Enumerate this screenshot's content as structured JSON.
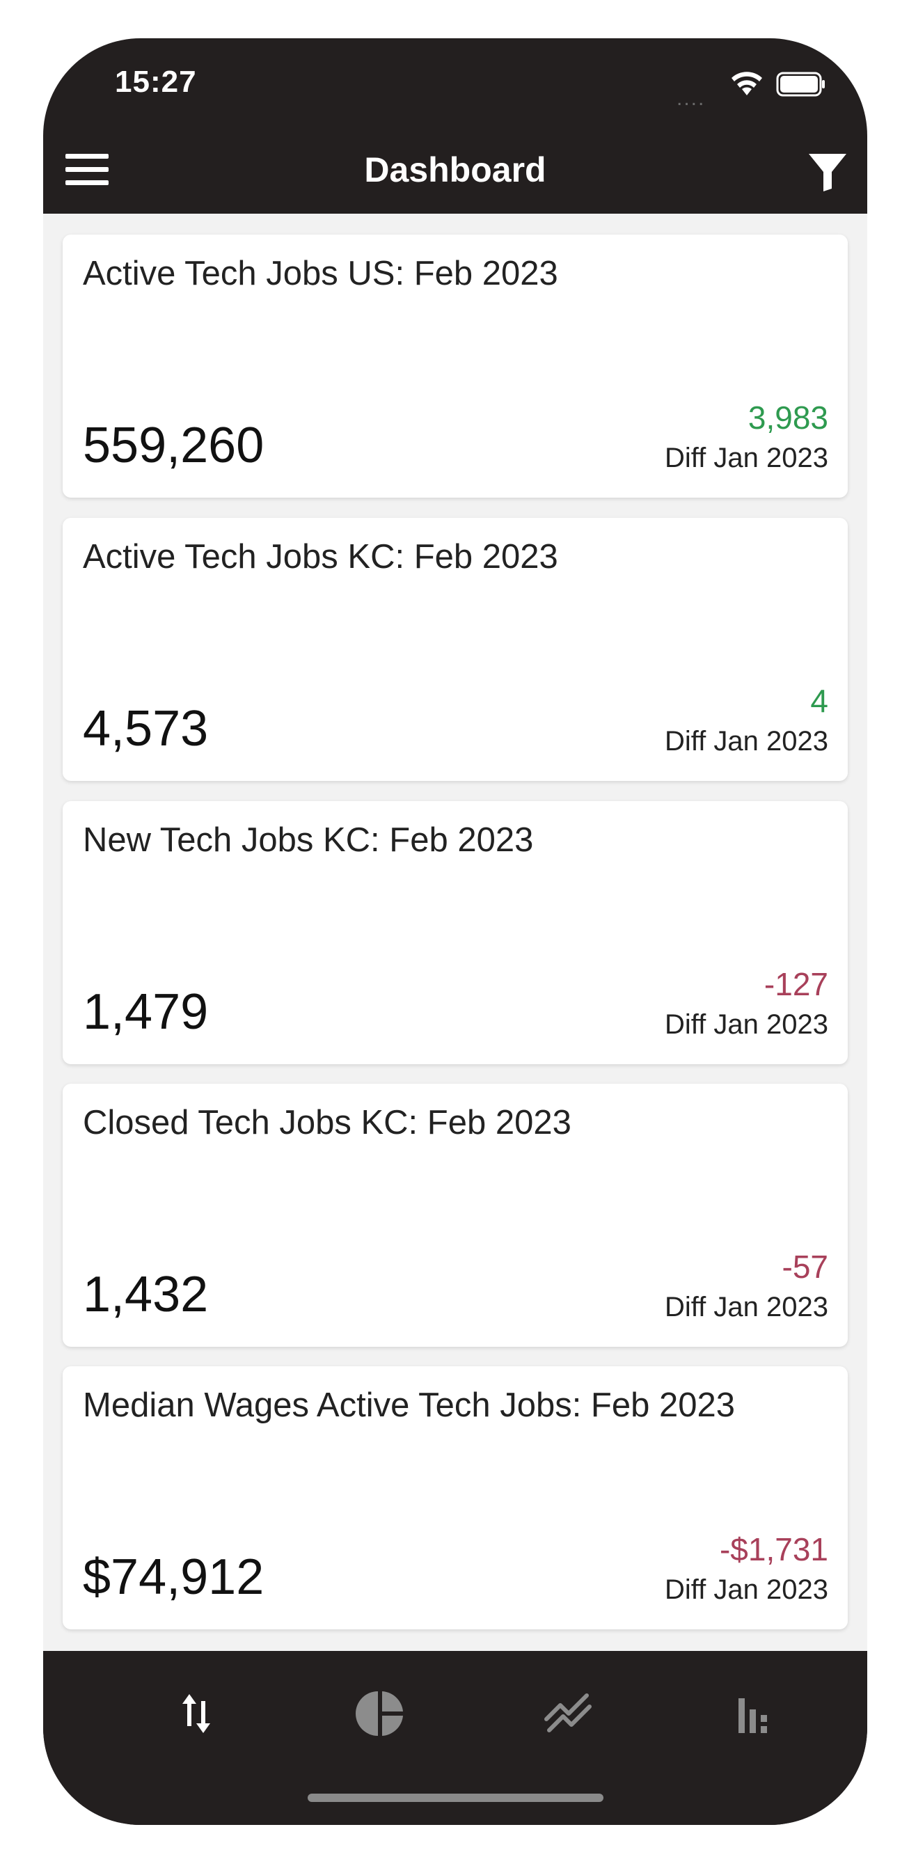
{
  "status_bar": {
    "time": "15:27",
    "signal": "....",
    "icons": [
      "wifi-icon",
      "battery-icon"
    ]
  },
  "navbar": {
    "title": "Dashboard",
    "left_icon": "menu-icon",
    "right_icon": "filter-icon"
  },
  "cards": [
    {
      "title": "Active Tech Jobs US: Feb 2023",
      "value": "559,260",
      "diff": "3,983",
      "diff_label": "Diff Jan 2023",
      "trend": "positive"
    },
    {
      "title": "Active Tech Jobs KC: Feb 2023",
      "value": "4,573",
      "diff": "4",
      "diff_label": "Diff Jan 2023",
      "trend": "positive"
    },
    {
      "title": "New Tech Jobs KC: Feb 2023",
      "value": "1,479",
      "diff": "-127",
      "diff_label": "Diff Jan 2023",
      "trend": "negative"
    },
    {
      "title": "Closed Tech Jobs KC: Feb 2023",
      "value": "1,432",
      "diff": "-57",
      "diff_label": "Diff Jan 2023",
      "trend": "negative"
    },
    {
      "title": "Median Wages Active Tech Jobs: Feb 2023",
      "value": "$74,912",
      "diff": "-$1,731",
      "diff_label": "Diff Jan 2023",
      "trend": "negative"
    }
  ],
  "tabbar": {
    "tabs": [
      "sort-arrows-icon",
      "pie-chart-icon",
      "line-chart-icon",
      "bar-chart-icon"
    ],
    "active_tab": "sort-arrows-icon"
  },
  "colors": {
    "chrome_background": "#231f1f",
    "content_background": "#f2f2f2",
    "positive": "#2e9a4f",
    "negative": "#a8405a",
    "tab_active": "#ffffff",
    "tab_inactive": "#8c8c8c"
  }
}
